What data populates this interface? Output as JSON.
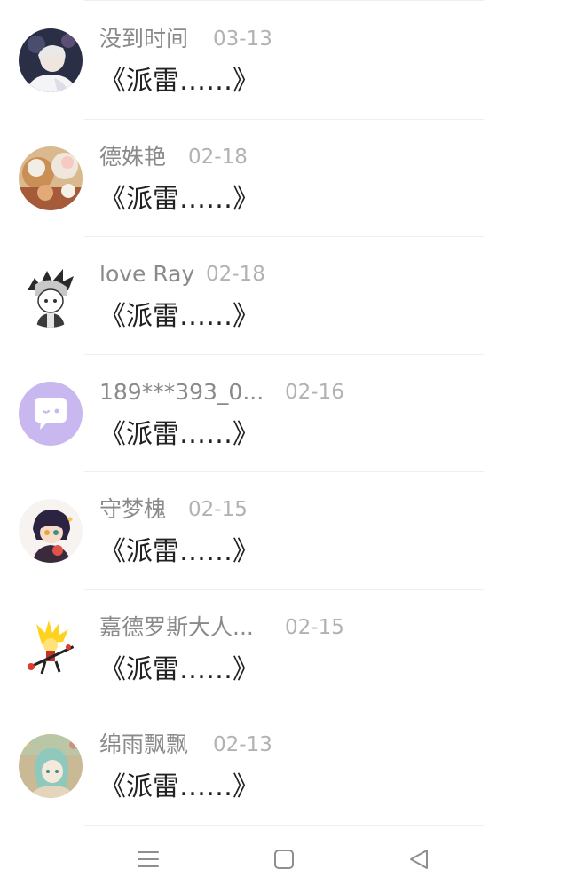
{
  "conversations": [
    {
      "name": "没到时间",
      "date": "03-13",
      "message": "《派雷……》",
      "avatar": "avatar-photo-person"
    },
    {
      "name": "德姝艳",
      "date": "02-18",
      "message": "《派雷……》",
      "avatar": "avatar-photo-food"
    },
    {
      "name": "love Ray",
      "date": "02-18",
      "message": "《派雷……》",
      "avatar": "avatar-anime-white-hair"
    },
    {
      "name": "189***393_0...",
      "date": "02-16",
      "message": "《派雷……》",
      "avatar": "avatar-default-chat-bubble"
    },
    {
      "name": "守梦槐",
      "date": "02-15",
      "message": "《派雷……》",
      "avatar": "avatar-anime-dark-hair"
    },
    {
      "name": "嘉德罗斯大人...",
      "date": "02-15",
      "message": "《派雷……》",
      "avatar": "avatar-anime-yellow-hair"
    },
    {
      "name": "绵雨飘飘",
      "date": "02-13",
      "message": "《派雷……》",
      "avatar": "avatar-anime-teal-hair"
    }
  ],
  "navbar": {
    "items": [
      "menu-icon",
      "home-square-icon",
      "back-triangle-icon"
    ]
  },
  "colors": {
    "name": "#8a8a8a",
    "date": "#b2b2b2",
    "message": "#222222",
    "divider": "#efefef",
    "default_avatar": "#c9b8ef"
  }
}
